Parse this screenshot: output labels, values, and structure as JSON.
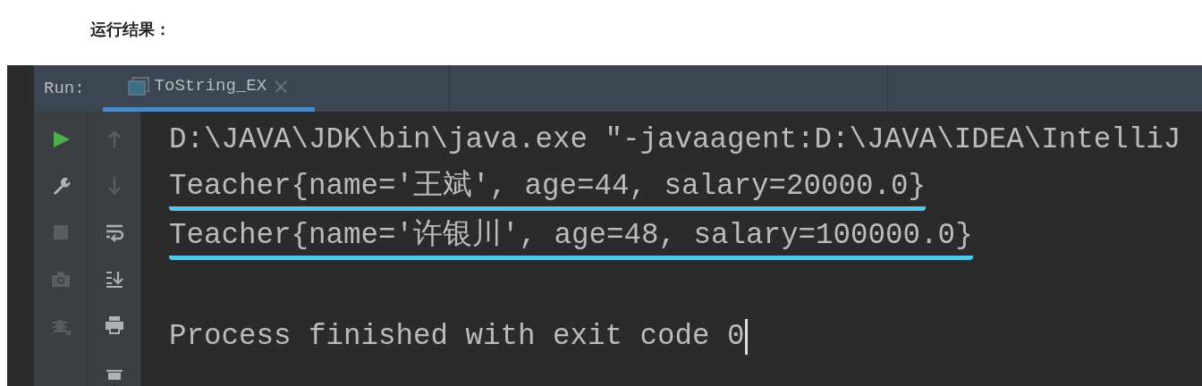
{
  "heading": "运行结果：",
  "run_panel": {
    "label": "Run:",
    "tabs": [
      {
        "label": "ToString_EX",
        "selected": true,
        "close": "×"
      }
    ],
    "left_toolbar": [
      {
        "kind": "run",
        "disabled": false
      },
      {
        "kind": "wrench",
        "disabled": false
      },
      {
        "kind": "stop",
        "disabled": true
      },
      {
        "kind": "camera",
        "disabled": true
      },
      {
        "kind": "debug",
        "disabled": true
      }
    ],
    "right_toolbar": [
      {
        "kind": "up",
        "disabled": true
      },
      {
        "kind": "down",
        "disabled": true
      },
      {
        "kind": "wrap",
        "disabled": false
      },
      {
        "kind": "scroll",
        "disabled": false
      },
      {
        "kind": "print",
        "disabled": false
      },
      {
        "kind": "trash",
        "disabled": false
      }
    ],
    "console": [
      {
        "kind": "output",
        "text": "D:\\JAVA\\JDK\\bin\\java.exe \"-javaagent:D:\\JAVA\\IDEA\\IntelliJ"
      },
      {
        "kind": "output",
        "text": "Teacher{name='王斌', age=44, salary=20000.0}",
        "underlined": true
      },
      {
        "kind": "output",
        "text": "Teacher{name='许银川', age=48, salary=100000.0}",
        "underlined": true
      },
      {
        "kind": "blank"
      },
      {
        "kind": "output",
        "text": "Process finished with exit code 0",
        "cursor": true
      }
    ]
  }
}
